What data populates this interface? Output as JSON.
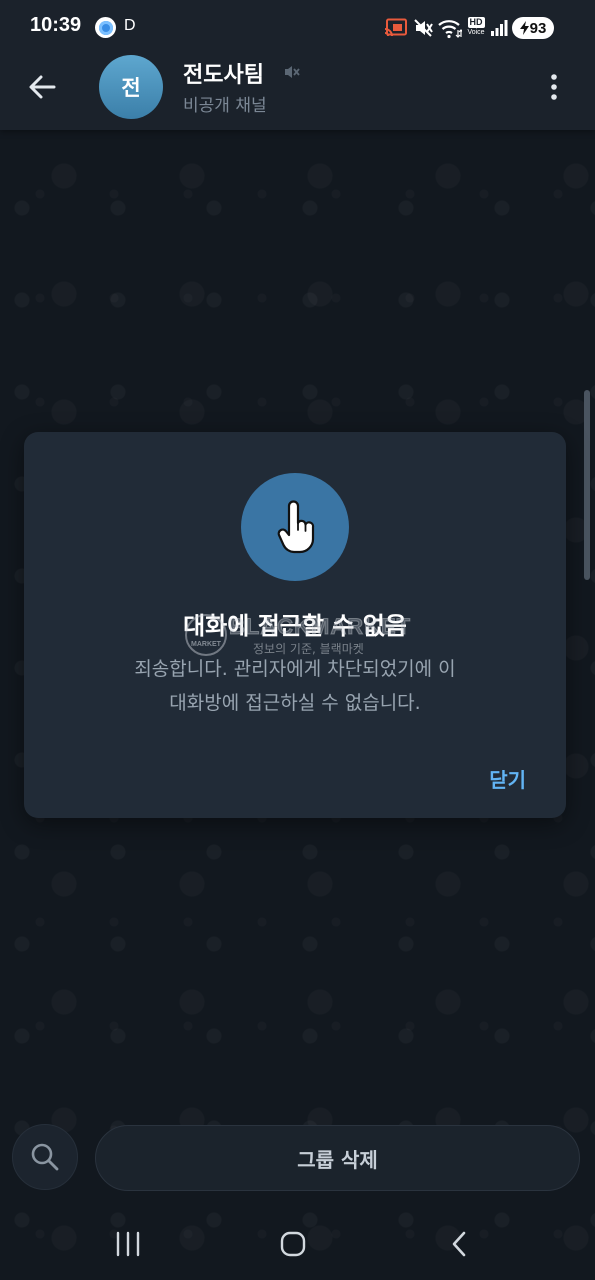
{
  "status_bar": {
    "time": "10:39",
    "carrier_letter": "D",
    "hd_top": "HD",
    "hd_bottom": "Voice",
    "battery": "93",
    "icons": [
      "app-notification-icon",
      "screen-cast-icon",
      "sound-mute-icon",
      "wifi-icon",
      "hd-voice-icon",
      "signal-icon",
      "battery-charging-icon"
    ]
  },
  "header": {
    "avatar_letter": "전",
    "title": "전도사팀",
    "subtitle": "비공개 채널",
    "icons": [
      "arrow-left-icon",
      "muted-speaker-icon",
      "more-vertical-icon"
    ]
  },
  "dialog": {
    "icon": "pointing-hand-icon",
    "title": "대화에 접근할 수 없음",
    "body_line1": "죄송합니다. 관리자에게 차단되었기에 이",
    "body_line2": "대화방에 접근하실 수 없습니다.",
    "close_label": "닫기"
  },
  "watermark": {
    "badge": "MARKET",
    "brand": "BLACKMARKET",
    "tagline": "정보의 기준, 블랙마켓"
  },
  "bottom": {
    "search_icon": "search-icon",
    "delete_group_label": "그룹 삭제"
  },
  "nav_bar": {
    "icons": [
      "recent-apps-icon",
      "home-icon",
      "back-chevron-icon"
    ]
  },
  "colors": {
    "accent": "#62b4f4",
    "header_bg": "#1b222b",
    "dialog_bg": "#212b37",
    "dialog_icon_circle": "#3a75a4",
    "background": "#12181f"
  }
}
